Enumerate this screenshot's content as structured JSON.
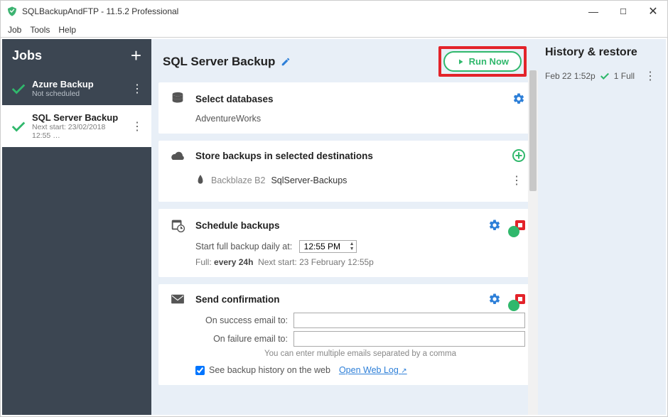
{
  "window": {
    "title": "SQLBackupAndFTP - 11.5.2 Professional"
  },
  "menu": {
    "job": "Job",
    "tools": "Tools",
    "help": "Help"
  },
  "sidebar": {
    "header": "Jobs",
    "items": [
      {
        "name": "Azure Backup",
        "sub": "Not scheduled"
      },
      {
        "name": "SQL Server Backup",
        "sub": "Next start: 23/02/2018 12:55 …"
      }
    ]
  },
  "main": {
    "title": "SQL Server Backup",
    "runNow": "Run Now",
    "selectDb": {
      "title": "Select databases",
      "db": "AdventureWorks"
    },
    "dest": {
      "title": "Store backups in selected destinations",
      "provider": "Backblaze B2",
      "target": "SqlServer-Backups"
    },
    "schedule": {
      "title": "Schedule backups",
      "label": "Start full backup daily at:",
      "time": "12:55 PM",
      "fullLabel": "Full:",
      "every": "every 24h",
      "nextLabel": "Next start:",
      "next": "23 February 12:55p"
    },
    "confirm": {
      "title": "Send confirmation",
      "success": "On success email to:",
      "failure": "On failure email to:",
      "hint": "You can enter multiple emails separated by a comma"
    },
    "weblog": {
      "label": "See backup history on the web",
      "link": "Open Web Log"
    }
  },
  "history": {
    "title": "History & restore",
    "row": {
      "date": "Feb 22 1:52p",
      "status": "1 Full"
    }
  }
}
